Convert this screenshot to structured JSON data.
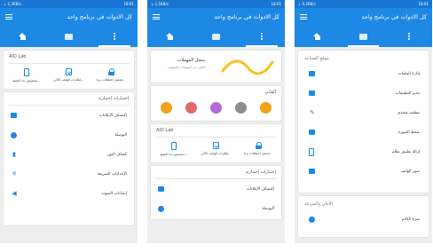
{
  "status": {
    "p1_left": "↓ 1,3KB/s",
    "p1_right": "18:01",
    "p2_left": "↓ 1,1KB/s",
    "p2_right": "18:01",
    "p3_left": "↓ 0,2KB/s",
    "p3_right": "18:01"
  },
  "app": {
    "title": "كل الادوات في برنامج واحد"
  },
  "lab": {
    "title": "AIO Lab",
    "items": [
      "تخصيص بدء التشغ...",
      "إطارات الهاتف الأكي...",
      "تحميل اختلافات برنا..."
    ]
  },
  "tests": {
    "title": "إختبارات إختباريه",
    "items": [
      "إكتشاف الإعلانات",
      "البوصلة",
      "كشاف النور",
      "الإعدادات السريعة",
      "إعدادات الصوت"
    ]
  },
  "battery": {
    "title": "سجل المهملات",
    "subtitle": "الكثير من المهملات للتنظيف"
  },
  "medals": {
    "title": "ألقابي",
    "items": [
      "",
      "",
      "",
      "",
      ""
    ]
  },
  "tools": {
    "title": "موقع الصناعة",
    "items": [
      "إدارة الملفات",
      "مدير التطبيقات",
      "تنظيف متقدم",
      "ضغط الصورة",
      "إزالة تطبيق نظام",
      "صور الهاتف"
    ]
  },
  "network": {
    "title": "الأمان والسرعة",
    "items": [
      "ميزة الكاتم"
    ]
  },
  "colors": {
    "primary": "#1e88e5",
    "statusbar": "#1976d2"
  }
}
